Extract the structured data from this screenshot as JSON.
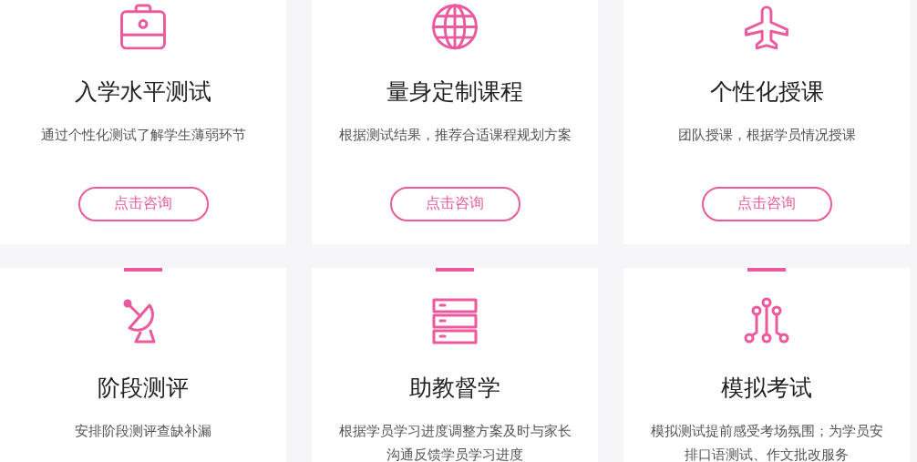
{
  "cards": [
    {
      "title": "入学水平测试",
      "description": "通过个性化测试了解学生薄弱环节",
      "button": "点击咨询",
      "accent_bar": false
    },
    {
      "title": "量身定制课程",
      "description": "根据测试结果，推荐合适课程规划方案",
      "button": "点击咨询",
      "accent_bar": false
    },
    {
      "title": "个性化授课",
      "description": "团队授课，根据学员情况授课",
      "button": "点击咨询",
      "accent_bar": false
    },
    {
      "title": "阶段测评",
      "description": "安排阶段测评查缺补漏",
      "accent_bar": true
    },
    {
      "title": "助教督学",
      "description": "根据学员学习进度调整方案及时与家长沟通反馈学员学习进度",
      "accent_bar": true
    },
    {
      "title": "模拟考试",
      "description": "模拟测试提前感受考场氛围；为学员安排口语测试、作文批改服务",
      "accent_bar": true
    }
  ]
}
